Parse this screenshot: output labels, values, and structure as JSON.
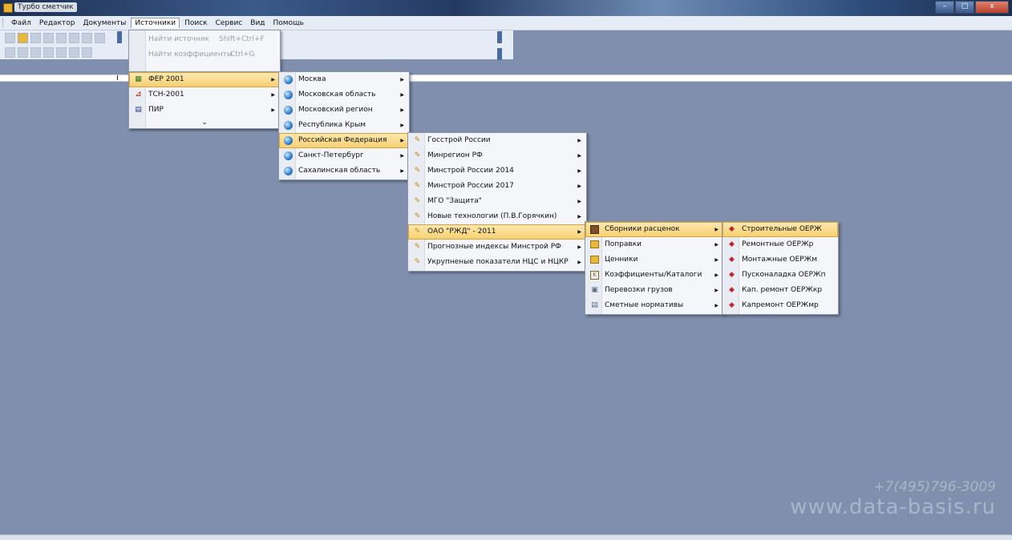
{
  "window": {
    "title": "Турбо сметчик",
    "buttons": [
      "–",
      "□",
      "x"
    ]
  },
  "menubar": [
    "Файл",
    "Редактор",
    "Документы",
    "Источники",
    "Поиск",
    "Сервис",
    "Вид",
    "Помощь"
  ],
  "menu_level0": {
    "items": [
      {
        "label": "Найти источник",
        "shortcut": "Shift+Ctrl+F"
      },
      {
        "label": "Найти коэффициенты",
        "shortcut": "Ctrl+G"
      }
    ]
  },
  "menu_level1": {
    "items": [
      {
        "label": "ФЕР 2001",
        "icon": "fer-icon"
      },
      {
        "label": "ТСН-2001",
        "icon": "tsn-icon"
      },
      {
        "label": "ПИР",
        "icon": "pir-icon"
      }
    ],
    "more": "⌄"
  },
  "menu_level2": {
    "items": [
      "Москва",
      "Московская область",
      "Московский регион",
      "Республика Крым",
      "Российская Федерация",
      "Санкт-Петербург",
      "Сахалинская область"
    ]
  },
  "menu_level3": {
    "items": [
      "Госстрой России",
      "Минрегион РФ",
      "Минстрой России 2014",
      "Минстрой России 2017",
      "МГО \"Защита\"",
      "Новые технологии (П.В.Горячкин)",
      "ОАО \"РЖД\" - 2011",
      "Прогнозные индексы Минстрой РФ",
      "Укрупненые показатели НЦС и НЦКР"
    ]
  },
  "menu_level4": {
    "items": [
      "Сборники расценок",
      "Поправки",
      "Ценники",
      "Коэффициенты/Каталоги",
      "Перевозки грузов",
      "Сметные нормативы"
    ]
  },
  "menu_level5": {
    "items": [
      "Строительные ОЕРЖ",
      "Ремонтные ОЕРЖр",
      "Монтажные ОЕРЖм",
      "Пусконаладка ОЕРЖп",
      "Кап. ремонт ОЕРЖкр",
      "Капремонт ОЕРЖмр"
    ]
  },
  "watermark": {
    "phone": "+7(495)796-3009",
    "site": "www.data-basis.ru"
  },
  "colors": {
    "desktop": "#7f8fad",
    "highlight": "#f7cf6e",
    "menu_bg": "#f4f6fa"
  }
}
